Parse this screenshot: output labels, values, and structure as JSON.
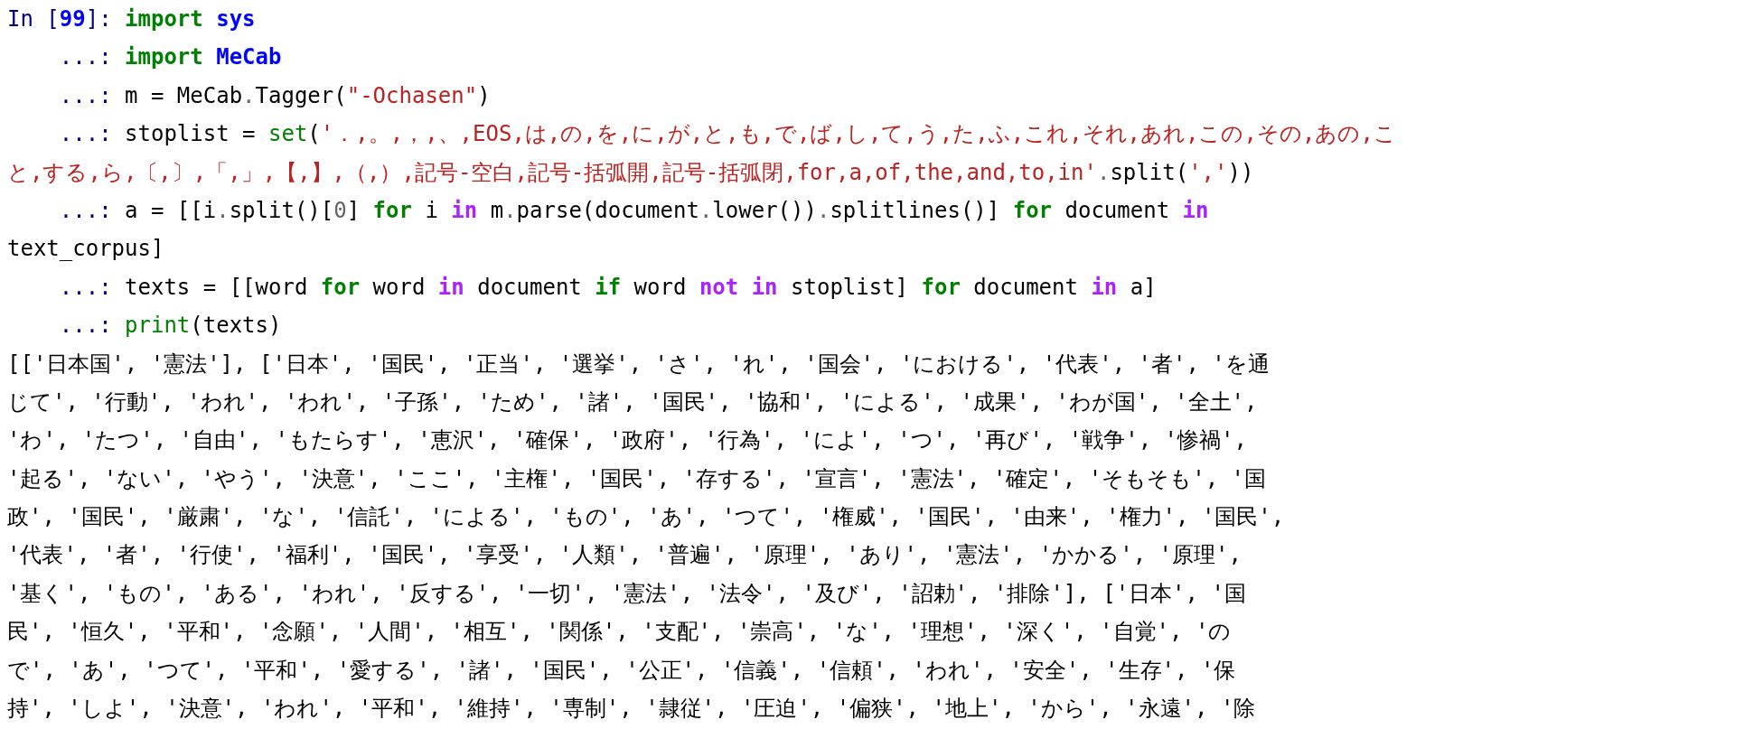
{
  "code_lines": [
    [
      {
        "kind": "prompt",
        "text": "In ["
      },
      {
        "kind": "count",
        "text": "99"
      },
      {
        "kind": "prompt",
        "text": "]: "
      },
      {
        "kind": "keyword",
        "text": "import"
      },
      {
        "kind": "module",
        "text": " sys"
      }
    ],
    [
      {
        "kind": "prompt",
        "text": "    ...: "
      },
      {
        "kind": "keyword",
        "text": "import"
      },
      {
        "kind": "module",
        "text": " MeCab"
      }
    ],
    [
      {
        "kind": "prompt",
        "text": "    ...: "
      },
      {
        "kind": "plain",
        "text": "m = MeCab"
      },
      {
        "kind": "op",
        "text": "."
      },
      {
        "kind": "plain",
        "text": "Tagger("
      },
      {
        "kind": "string",
        "text": "\"-Ochasen\""
      },
      {
        "kind": "plain",
        "text": ")"
      }
    ],
    [
      {
        "kind": "prompt",
        "text": "    ...: "
      },
      {
        "kind": "plain",
        "text": "stoplist = "
      },
      {
        "kind": "builtin",
        "text": "set"
      },
      {
        "kind": "plain",
        "text": "("
      },
      {
        "kind": "string",
        "text": "'．,。,，,、,EOS,は,の,を,に,が,と,も,で,ば,し,て,う,た,ふ,これ,それ,あれ,この,その,あの,こ"
      }
    ],
    [
      {
        "kind": "string",
        "text": "と,する,ら,〔,〕,「,」,【,】,（,）,記号-空白,記号-括弧開,記号-括弧閉,for,a,of,the,and,to,in'"
      },
      {
        "kind": "op",
        "text": "."
      },
      {
        "kind": "plain",
        "text": "split("
      },
      {
        "kind": "string",
        "text": "','"
      },
      {
        "kind": "plain",
        "text": "))"
      }
    ],
    [
      {
        "kind": "prompt",
        "text": "    ...: "
      },
      {
        "kind": "plain",
        "text": "a = [[i"
      },
      {
        "kind": "op",
        "text": "."
      },
      {
        "kind": "plain",
        "text": "split()["
      },
      {
        "kind": "number",
        "text": "0"
      },
      {
        "kind": "plain",
        "text": "] "
      },
      {
        "kind": "keyword",
        "text": "for"
      },
      {
        "kind": "plain",
        "text": " i "
      },
      {
        "kind": "operator_word",
        "text": "in"
      },
      {
        "kind": "plain",
        "text": " m"
      },
      {
        "kind": "op",
        "text": "."
      },
      {
        "kind": "plain",
        "text": "parse(document"
      },
      {
        "kind": "op",
        "text": "."
      },
      {
        "kind": "plain",
        "text": "lower())"
      },
      {
        "kind": "op",
        "text": "."
      },
      {
        "kind": "plain",
        "text": "splitlines()] "
      },
      {
        "kind": "keyword",
        "text": "for"
      },
      {
        "kind": "plain",
        "text": " document "
      },
      {
        "kind": "operator_word",
        "text": "in"
      }
    ],
    [
      {
        "kind": "plain",
        "text": "text_corpus]"
      }
    ],
    [
      {
        "kind": "prompt",
        "text": "    ...: "
      },
      {
        "kind": "plain",
        "text": "texts = [[word "
      },
      {
        "kind": "keyword",
        "text": "for"
      },
      {
        "kind": "plain",
        "text": " word "
      },
      {
        "kind": "operator_word",
        "text": "in"
      },
      {
        "kind": "plain",
        "text": " document "
      },
      {
        "kind": "keyword",
        "text": "if"
      },
      {
        "kind": "plain",
        "text": " word "
      },
      {
        "kind": "operator_word",
        "text": "not in"
      },
      {
        "kind": "plain",
        "text": " stoplist] "
      },
      {
        "kind": "keyword",
        "text": "for"
      },
      {
        "kind": "plain",
        "text": " document "
      },
      {
        "kind": "operator_word",
        "text": "in"
      },
      {
        "kind": "plain",
        "text": " a]"
      }
    ],
    [
      {
        "kind": "prompt",
        "text": "    ...: "
      },
      {
        "kind": "builtin",
        "text": "print"
      },
      {
        "kind": "plain",
        "text": "(texts)"
      }
    ]
  ],
  "output_lines": [
    "[['日本国', '憲法'], ['日本', '国民', '正当', '選挙', 'さ', 'れ', '国会', 'における', '代表', '者', 'を通",
    "じて', '行動', 'われ', 'われ', '子孫', 'ため', '諸', '国民', '協和', 'による', '成果', 'わが国', '全土',",
    "'わ', 'たつ', '自由', 'もたらす', '恵沢', '確保', '政府', '行為', 'によ', 'つ', '再び', '戦争', '惨禍',",
    "'起る', 'ない', 'やう', '決意', 'ここ', '主権', '国民', '存する', '宣言', '憲法', '確定', 'そもそも', '国",
    "政', '国民', '厳粛', 'な', '信託', 'による', 'もの', 'あ', 'つて', '権威', '国民', '由来', '権力', '国民',",
    "'代表', '者', '行使', '福利', '国民', '享受', '人類', '普遍', '原理', 'あり', '憲法', 'かかる', '原理',",
    "'基く', 'もの', 'ある', 'われ', '反する', '一切', '憲法', '法令', '及び', '詔勅', '排除'], ['日本', '国",
    "民', '恒久', '平和', '念願', '人間', '相互', '関係', '支配', '崇高', 'な', '理想', '深く', '自覚', 'の",
    "で', 'あ', 'つて', '平和', '愛する', '諸', '国民', '公正', '信義', '信頼', 'われ', '安全', '生存', '保",
    "持', 'しよ', '決意', 'われ', '平和', '維持', '専制', '隷従', '圧迫', '偏狭', '地上', 'から', '永遠', '除"
  ]
}
